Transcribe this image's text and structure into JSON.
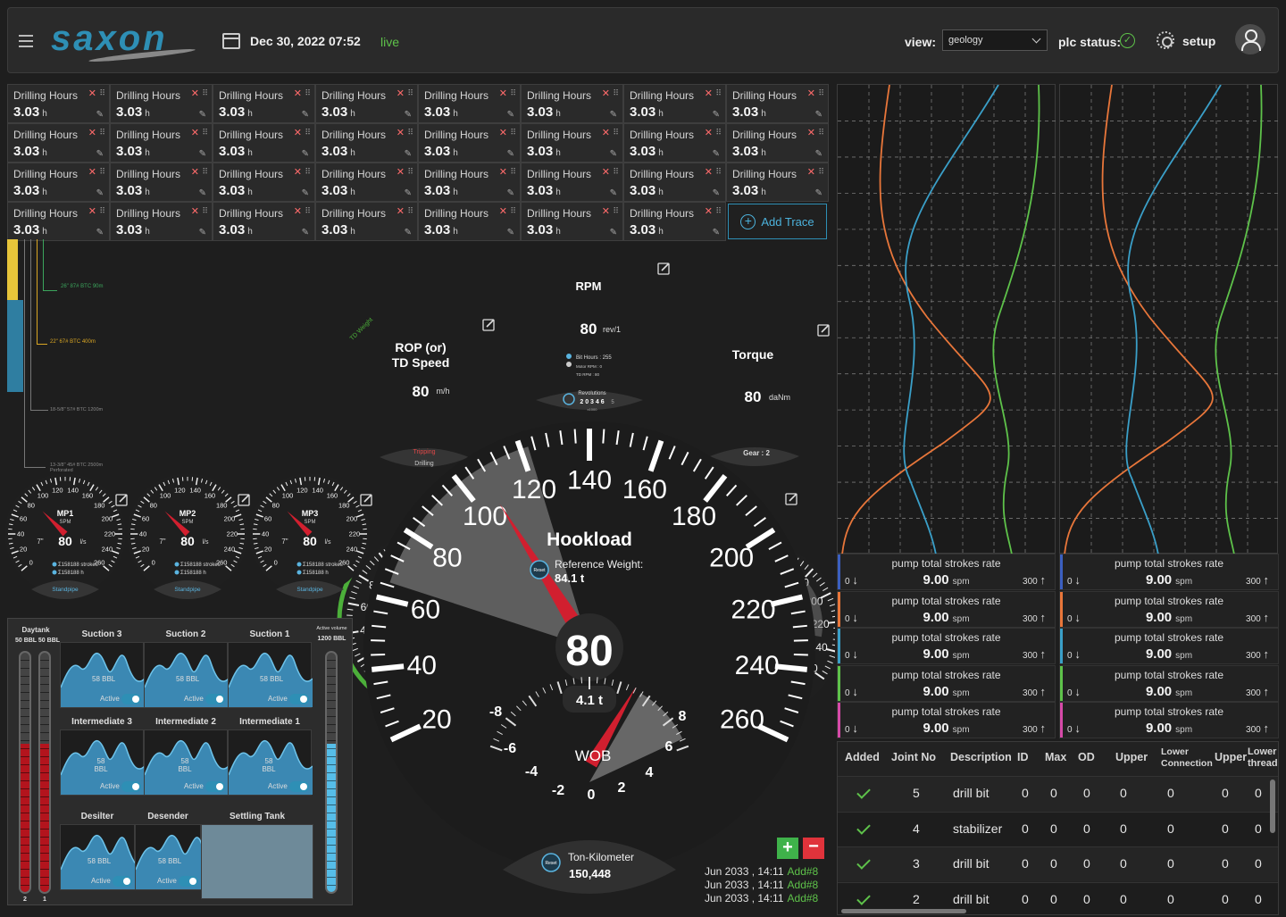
{
  "header": {
    "date": "Dec 30, 2022 07:52",
    "live": "live",
    "logo": "saxon",
    "view_label": "view:",
    "view_value": "geology",
    "plc_label": "plc status:",
    "setup_label": "setup"
  },
  "tiles": {
    "label": "Drilling Hours",
    "value": "3.03",
    "unit": "h",
    "count": 31,
    "add_trace": "Add Trace"
  },
  "well": {
    "casings": [
      "26\" 87# BTC 90m",
      "22\" 67# BTC 400m",
      "18-5/8\" 57# BTC 1200m",
      "13-3/8\" 45# BTC 2500m Perforated"
    ]
  },
  "gauges": {
    "rop": {
      "title1": "ROP (or)",
      "title2": "TD Speed",
      "value": "80",
      "unit": "m/h",
      "arc": "TD Weight",
      "footer1": "Tripping",
      "footer2": "Drilling",
      "ticks": [
        "0",
        "20",
        "40",
        "60",
        "80",
        "100",
        "120",
        "140",
        "160",
        "180",
        "200",
        "220",
        "240",
        "260"
      ]
    },
    "rpm": {
      "title": "RPM",
      "value": "80",
      "unit": "rev/1",
      "info1": "Bit Hours : 255",
      "info2": "Motor RPM : 0",
      "info3": "TD RPM : 80",
      "rev_label": "Revolutions",
      "rev_value": "2 0 3 4 6",
      "rev_unit": "5",
      "rev_mult": "x1000",
      "ticks": [
        "0",
        "20",
        "40",
        "60",
        "80",
        "100",
        "120",
        "140",
        "160",
        "180",
        "200",
        "220",
        "240",
        "260"
      ]
    },
    "torque": {
      "title": "Torque",
      "value": "80",
      "unit": "daNm",
      "footer": "Gear : 2",
      "ticks": [
        "0",
        "20",
        "40",
        "60",
        "80",
        "100",
        "120",
        "140",
        "160",
        "180",
        "200",
        "220",
        "240",
        "260"
      ]
    },
    "hookload": {
      "title": "Hookload",
      "value": "80",
      "ref_label": "Reference Weight:",
      "ref_value": "84.1 t",
      "wob_value": "4.1 t",
      "wob_label": "WOB",
      "ton_label": "Ton-Kilometer",
      "ton_value": "150,448",
      "reset": "Reset",
      "ticks": [
        "20",
        "40",
        "60",
        "80",
        "100",
        "120",
        "140",
        "160",
        "180",
        "200",
        "220",
        "240",
        "260"
      ],
      "wob_ticks": [
        "-8",
        "-6",
        "-4",
        "-2",
        "0",
        "2",
        "4",
        "6",
        "8"
      ]
    },
    "mp": [
      {
        "title": "MP1",
        "sub": "SPM",
        "value": "80",
        "unit": "l/s",
        "strokes": "158188 strokes",
        "liters": "158188 h",
        "footer": "Standpipe",
        "side": "7\""
      },
      {
        "title": "MP2",
        "sub": "SPM",
        "value": "80",
        "unit": "l/s",
        "strokes": "158188 strokes",
        "liters": "158188 h",
        "footer": "Standpipe",
        "side": "7\""
      },
      {
        "title": "MP3",
        "sub": "SPM",
        "value": "80",
        "unit": "l/s",
        "strokes": "158188 strokes",
        "liters": "158188 h",
        "footer": "Standpipe",
        "side": "7\""
      }
    ],
    "mp_ticks": [
      "0",
      "20",
      "40",
      "60",
      "80",
      "100",
      "120",
      "140",
      "160",
      "180",
      "200",
      "220",
      "240",
      "260"
    ]
  },
  "pits": {
    "daytank": "Daytank",
    "daytank_vals": "50 BBL 50 BBL",
    "active_volume": "Active volume",
    "active_value": "1200 BBL",
    "tube_labels": [
      "2",
      "1"
    ],
    "cells": [
      {
        "name": "Suction 3",
        "vol": "58 BBL",
        "state": "Active"
      },
      {
        "name": "Suction 2",
        "vol": "58 BBL",
        "state": "Active"
      },
      {
        "name": "Suction 1",
        "vol": "58 BBL",
        "state": "Active"
      },
      {
        "name": "Intermediate 3",
        "vol": "58 BBL",
        "state": "Active"
      },
      {
        "name": "Intermediate 2",
        "vol": "58 BBL",
        "state": "Active"
      },
      {
        "name": "Intermediate 1",
        "vol": "58 BBL",
        "state": "Active"
      },
      {
        "name": "Desilter",
        "vol": "58 BBL",
        "state": "Active"
      },
      {
        "name": "Desender",
        "vol": "58 BBL",
        "state": "Active"
      },
      {
        "name": "Settling Tank",
        "vol": "",
        "state": ""
      }
    ]
  },
  "log": [
    {
      "time": "Jun 2033 , 14:11",
      "tag": "Add#8"
    },
    {
      "time": "Jun 2033 , 14:11",
      "tag": "Add#8"
    },
    {
      "time": "Jun 2033 , 14:11",
      "tag": "Add#8"
    }
  ],
  "traces": {
    "title": "pump total strokes rate",
    "value": "9.00",
    "unit": "spm",
    "min": "0",
    "max": "300",
    "colors": [
      "#3b5fc0",
      "#e8763a",
      "#3a9fc8",
      "#5ec24a",
      "#d64aa8"
    ]
  },
  "series_colors": [
    "#e8763a",
    "#3a9fc8",
    "#5ec24a"
  ],
  "table": {
    "headers": [
      "Added",
      "Joint No",
      "Description",
      "ID",
      "Max",
      "OD",
      "Upper",
      "Lower Connection",
      "Upper",
      "Lower thread"
    ],
    "rows": [
      {
        "joint": "5",
        "desc": "drill bit",
        "v": [
          "0",
          "0",
          "0",
          "0",
          "0",
          "0",
          "0"
        ]
      },
      {
        "joint": "4",
        "desc": "stabilizer",
        "v": [
          "0",
          "0",
          "0",
          "0",
          "0",
          "0",
          "0"
        ]
      },
      {
        "joint": "3",
        "desc": "drill bit",
        "v": [
          "0",
          "0",
          "0",
          "0",
          "0",
          "0",
          "0"
        ]
      },
      {
        "joint": "2",
        "desc": "drill bit",
        "v": [
          "0",
          "0",
          "0",
          "0",
          "0",
          "0",
          "0"
        ]
      }
    ]
  }
}
